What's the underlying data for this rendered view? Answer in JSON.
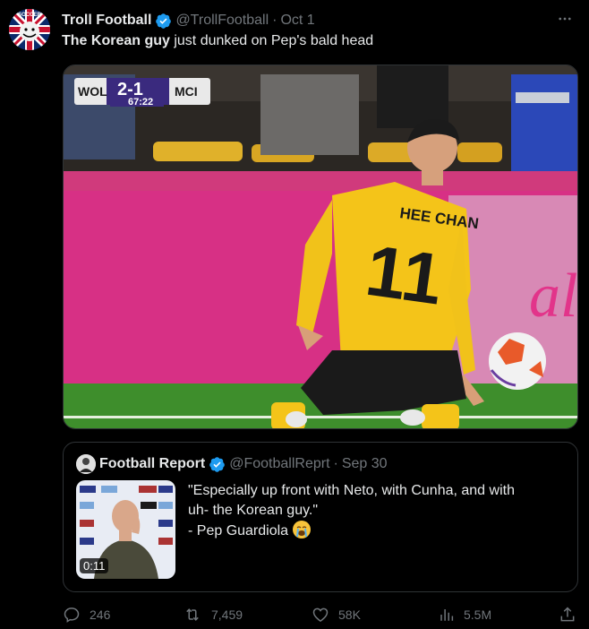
{
  "tweet": {
    "author_name": "Troll Football",
    "handle": "@TrollFootball",
    "separator": "·",
    "date": "Oct 1",
    "text_bold": "The Korean guy",
    "text_rest": " just dunked on Pep's bald head",
    "avatar_label": "SOCCER"
  },
  "media": {
    "scoreboard_home": "WOL",
    "scoreboard_score": "2-1",
    "scoreboard_away": "MCI",
    "scoreboard_time": "67:22",
    "shirt_name": "HEE CHAN",
    "shirt_number": "11"
  },
  "quote": {
    "author_name": "Football Report",
    "handle": "@FootballReprt",
    "separator": "·",
    "date": "Sep 30",
    "duration": "0:11",
    "lines": [
      "\"Especially up front with Neto, with Cunha, and with",
      "uh- the Korean guy.\"",
      "- Pep Guardiola"
    ]
  },
  "actions": {
    "replies": "246",
    "reposts": "7,459",
    "likes": "58K",
    "views": "5.5M"
  },
  "colors": {
    "background": "#000000",
    "text": "#e7e9ea",
    "muted": "#71767b",
    "verified": "#1d9bf0",
    "border": "#2f3336"
  }
}
